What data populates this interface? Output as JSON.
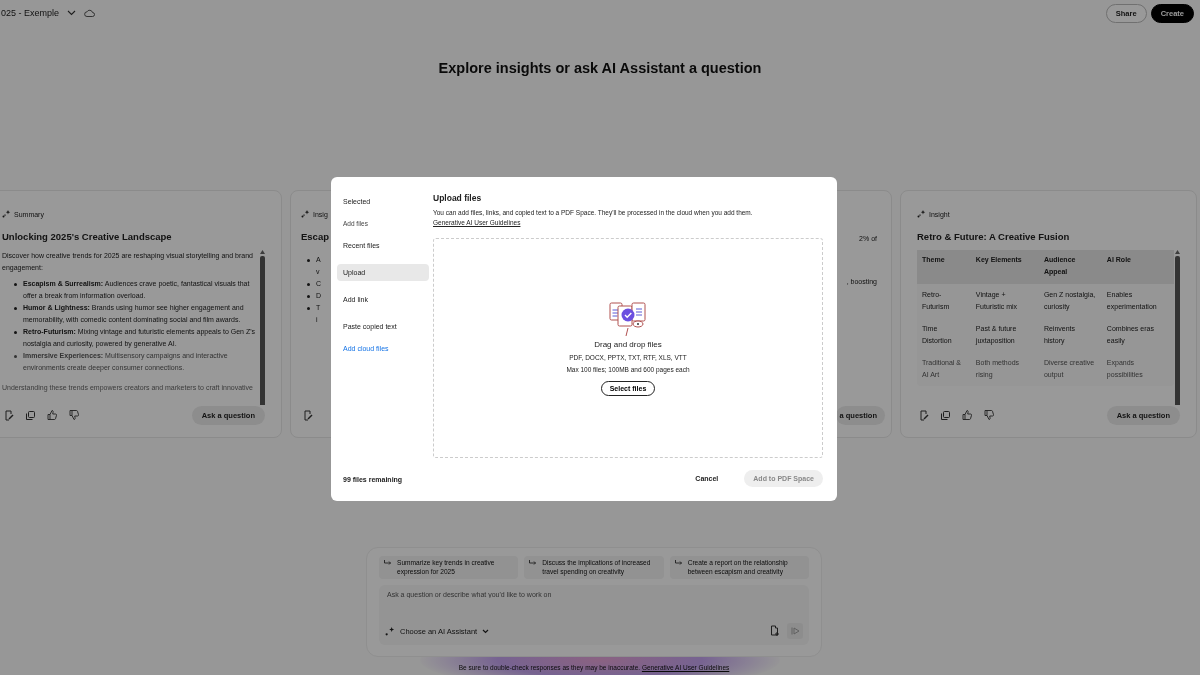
{
  "header": {
    "title": "025 - Exemple",
    "buttons": [
      {
        "label": "Share",
        "kind": "secondary"
      },
      {
        "label": "Create",
        "kind": "primary"
      }
    ]
  },
  "heading": "Explore insights or ask AI Assistant a question",
  "cards": [
    {
      "kind": "text",
      "badge": "Summary",
      "title": "Unlocking 2025's Creative Landscape",
      "intro": "Discover how creative trends for 2025 are reshaping visual storytelling and brand engagement:",
      "bullets": [
        "**Escapism & Surrealism:** Audiences crave poetic, fantastical visuals that offer a break from information overload.",
        "**Humor & Lightness:** Brands using humor see higher engagement and memorability, with comedic content dominating social and film awards.",
        "**Retro-Futurism:** Mixing vintage and futuristic elements appeals to Gen Z's nostalgia and curiosity, powered by generative AI.",
        "**Immersive Experiences:** Multisensory campaigns and interactive environments create deeper consumer connections."
      ],
      "faded": "Understanding these trends empowers creators and marketers to craft innovative",
      "ask": "Ask a question"
    },
    {
      "kind": "clipped_left",
      "badge": "Insig",
      "title": "Escap",
      "bullets": [
        [
          "A",
          "v"
        ],
        [
          "C"
        ],
        [
          "D"
        ],
        [
          "T",
          "i"
        ]
      ]
    },
    {
      "kind": "clipped_right",
      "lines": [
        "2% of",
        ", boosting"
      ],
      "ask": "a question"
    },
    {
      "kind": "table",
      "badge": "Insight",
      "title": "Retro & Future: A Creative Fusion",
      "columns": [
        "Theme",
        "Key Elements",
        "Audience Appeal",
        "AI Role"
      ],
      "rows": [
        [
          "Retro-Futurism",
          "Vintage + Futuristic mix",
          "Gen Z nostalgia, curiosity",
          "Enables experimentation"
        ],
        [
          "Time Distortion",
          "Past & future juxtaposition",
          "Reinvents history",
          "Combines eras easily"
        ],
        [
          "Traditional & AI Art",
          "Both methods rising",
          "Diverse creative output",
          "Expands possibilities"
        ]
      ],
      "ask": "Ask a question"
    }
  ],
  "prompt": {
    "suggestions": [
      "Summarize key trends in creative expression for 2025",
      "Discuss the implications of increased travel spending on creativity",
      "Create a report on the relationship between escapism and creativity"
    ],
    "placeholder": "Ask a question or describe what you'd like to work on",
    "assistant": "Choose an AI Assistant",
    "send_disabled": true
  },
  "disclaimer": {
    "text": "Be sure to double-check responses as they may be inaccurate.",
    "link": "Generative AI User Guidelines"
  },
  "dialog": {
    "nav": [
      {
        "label": "Selected",
        "kind": "item",
        "selected": false
      },
      {
        "label": "Add files",
        "kind": "section"
      },
      {
        "label": "Recent files",
        "kind": "item",
        "selected": false
      },
      {
        "label": "Upload",
        "kind": "item",
        "selected": true
      },
      {
        "label": "Add link",
        "kind": "item",
        "selected": false
      },
      {
        "label": "Paste copied text",
        "kind": "item",
        "selected": false
      },
      {
        "label": "Add cloud files",
        "kind": "link"
      }
    ],
    "title": "Upload files",
    "description": "You can add files, links, and copied text to a PDF Space. They'll be processed in the cloud when you add them.",
    "description_link": "Generative AI User Guidelines",
    "drop_title": "Drag and drop files",
    "formats": "PDF, DOCX, PPTX, TXT, RTF, XLS, VTT",
    "limits": "Max 100 files; 100MB and 600 pages each",
    "select_button": "Select files",
    "remaining": "99 files remaining",
    "cancel": "Cancel",
    "confirm": {
      "label": "Add to PDF Space",
      "disabled": true
    }
  }
}
